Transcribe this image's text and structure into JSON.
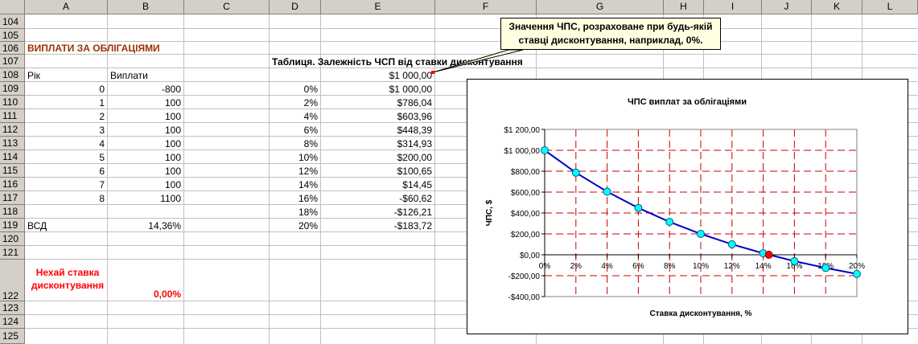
{
  "columns": [
    "A",
    "B",
    "C",
    "D",
    "E",
    "F",
    "G",
    "H",
    "I",
    "J",
    "K",
    "L"
  ],
  "rows": [
    "104",
    "105",
    "106",
    "107",
    "108",
    "109",
    "110",
    "111",
    "112",
    "113",
    "114",
    "115",
    "116",
    "117",
    "118",
    "119",
    "120",
    "121",
    "122",
    "123",
    "124",
    "125"
  ],
  "title": "ВИПЛАТИ ЗА ОБЛІГАЦІЯМИ",
  "col_year_header": "Рік",
  "col_pay_header": "Виплати",
  "years": [
    "0",
    "1",
    "2",
    "3",
    "4",
    "5",
    "6",
    "7",
    "8"
  ],
  "payments": [
    "-800",
    "100",
    "100",
    "100",
    "100",
    "100",
    "100",
    "100",
    "1100"
  ],
  "irr_label": "ВСД",
  "irr_value": "14,36%",
  "let_rate_label_1": "Нехай ставка",
  "let_rate_label_2": "дисконтування",
  "let_rate_value": "0,00%",
  "table_title": "Таблиця. Залежність ЧСП від ставки дисконтування",
  "npv_top": "$1 000,00",
  "rates": [
    "0%",
    "2%",
    "4%",
    "6%",
    "8%",
    "10%",
    "12%",
    "14%",
    "16%",
    "18%",
    "20%"
  ],
  "npvs": [
    "$1 000,00",
    "$786,04",
    "$603,96",
    "$448,39",
    "$314,93",
    "$200,00",
    "$100,65",
    "$14,45",
    "-$60,62",
    "-$126,21",
    "-$183,72"
  ],
  "callout_text_1": "Значення ЧПС, розраховане при будь-якій",
  "callout_text_2": "ставці дисконтування, наприклад, 0%.",
  "colors": {
    "title": "#993300",
    "red": "#ff0000",
    "line": "#0000cc",
    "marker": "#00ffff",
    "grid": "#cc0000",
    "highlight_marker": "#ff0000"
  },
  "chart_data": {
    "type": "line",
    "title": "ЧПС виплат за облігаціями",
    "xlabel": "Ставка дисконтування, %",
    "ylabel": "ЧПС, $",
    "x": [
      0,
      2,
      4,
      6,
      8,
      10,
      12,
      14,
      16,
      18,
      20
    ],
    "x_tick_labels": [
      "0%",
      "2%",
      "4%",
      "6%",
      "8%",
      "10%",
      "12%",
      "14%",
      "16%",
      "18%",
      "20%"
    ],
    "y_tick_values": [
      1200,
      1000,
      800,
      600,
      400,
      200,
      0,
      -200,
      -400
    ],
    "y_tick_labels": [
      "$1 200,00",
      "$1 000,00",
      "$800,00",
      "$600,00",
      "$400,00",
      "$200,00",
      "$0,00",
      "-$200,00",
      "-$400,00"
    ],
    "ylim": [
      -400,
      1200
    ],
    "xlim": [
      0,
      20
    ],
    "series": [
      {
        "values": [
          1000,
          786.04,
          603.96,
          448.39,
          314.93,
          200,
          100.65,
          14.45,
          -60.62,
          -126.21,
          -183.72
        ]
      }
    ],
    "highlight_point": {
      "x": 14.36,
      "y": 0
    },
    "grid": true
  }
}
